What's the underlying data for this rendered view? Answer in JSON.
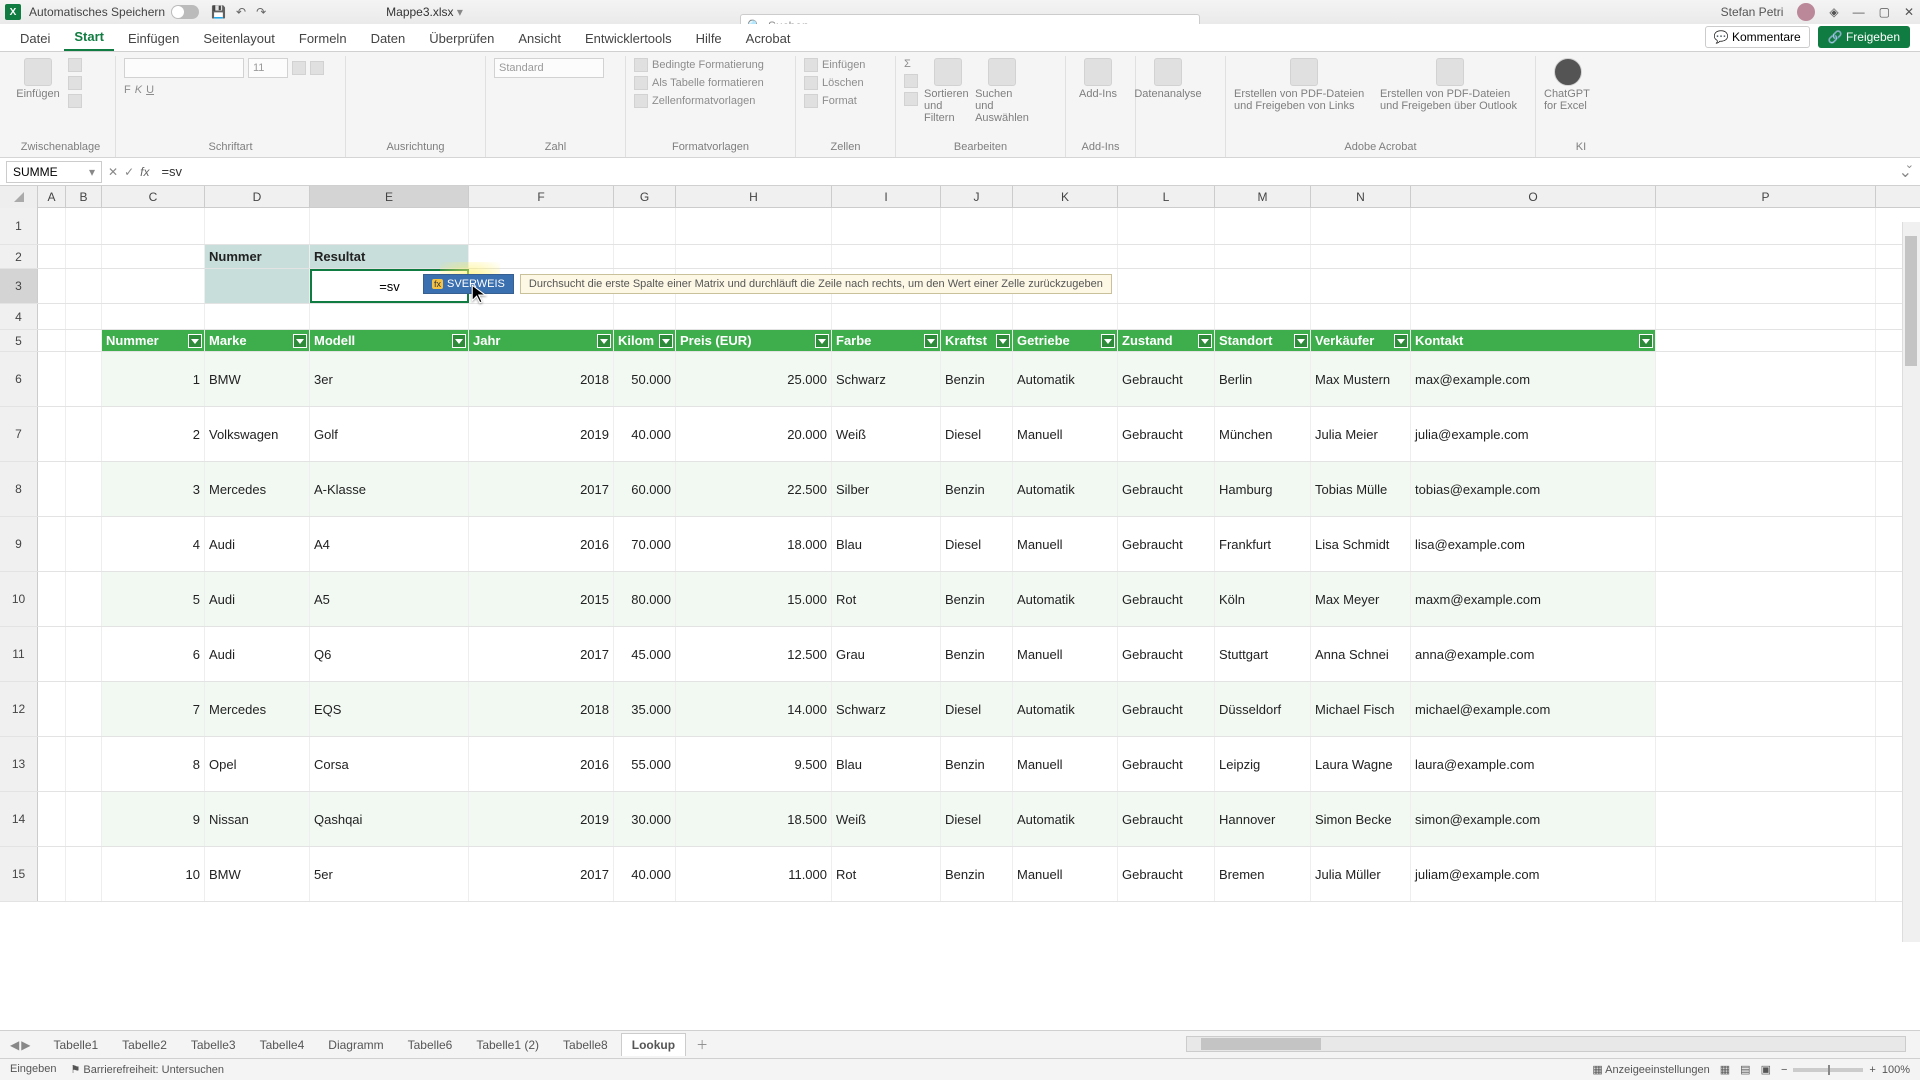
{
  "titlebar": {
    "autosave_label": "Automatisches Speichern",
    "doc_name": "Mappe3.xlsx",
    "search_placeholder": "Suchen",
    "user_name": "Stefan Petri"
  },
  "menu": {
    "tabs": [
      "Datei",
      "Start",
      "Einfügen",
      "Seitenlayout",
      "Formeln",
      "Daten",
      "Überprüfen",
      "Ansicht",
      "Entwicklertools",
      "Hilfe",
      "Acrobat"
    ],
    "active": 1,
    "comments": "Kommentare",
    "share": "Freigeben"
  },
  "ribbon": {
    "groups": {
      "clipboard": "Zwischenablage",
      "clipboard_btn": "Einfügen",
      "font": "Schriftart",
      "align": "Ausrichtung",
      "number": "Zahl",
      "number_fmt": "Standard",
      "styles": "Formatvorlagen",
      "styles_items": [
        "Bedingte Formatierung",
        "Als Tabelle formatieren",
        "Zellenformatvorlagen"
      ],
      "cells": "Zellen",
      "cells_items": [
        "Einfügen",
        "Löschen",
        "Format"
      ],
      "edit": "Bearbeiten",
      "edit_sort": "Sortieren und Filtern",
      "edit_find": "Suchen und Auswählen",
      "addins": "Add-Ins",
      "addins_btn": "Add-Ins",
      "analysis": "Datenanalyse",
      "acrobat": "Adobe Acrobat",
      "acrobat1": "Erstellen von PDF-Dateien und Freigeben von Links",
      "acrobat2": "Erstellen von PDF-Dateien und Freigeben über Outlook",
      "ai": "KI",
      "ai_btn": "ChatGPT for Excel"
    }
  },
  "fbar": {
    "namebox": "SUMME",
    "formula": "=sv"
  },
  "columns": [
    "A",
    "B",
    "C",
    "D",
    "E",
    "F",
    "G",
    "H",
    "I",
    "J",
    "K",
    "L",
    "M",
    "N",
    "O",
    "P"
  ],
  "lookup": {
    "nummer": "Nummer",
    "resultat": "Resultat",
    "editing": "=sv"
  },
  "autocomplete": {
    "fn": "SVERWEIS",
    "tip": "Durchsucht die erste Spalte einer Matrix und durchläuft die Zeile nach rechts, um den Wert einer Zelle zurückzugeben"
  },
  "table": {
    "headers": [
      "Nummer",
      "Marke",
      "Modell",
      "Jahr",
      "Kilom",
      "Preis (EUR)",
      "Farbe",
      "Kraftst",
      "Getriebe",
      "Zustand",
      "Standort",
      "Verkäufer",
      "Kontakt"
    ],
    "rows": [
      {
        "n": "1",
        "marke": "BMW",
        "modell": "3er",
        "jahr": "2018",
        "km": "50.000",
        "preis": "25.000",
        "farbe": "Schwarz",
        "kraft": "Benzin",
        "getr": "Automatik",
        "zust": "Gebraucht",
        "ort": "Berlin",
        "verk": "Max Mustern",
        "kontakt": "max@example.com"
      },
      {
        "n": "2",
        "marke": "Volkswagen",
        "modell": "Golf",
        "jahr": "2019",
        "km": "40.000",
        "preis": "20.000",
        "farbe": "Weiß",
        "kraft": "Diesel",
        "getr": "Manuell",
        "zust": "Gebraucht",
        "ort": "München",
        "verk": "Julia Meier",
        "kontakt": "julia@example.com"
      },
      {
        "n": "3",
        "marke": "Mercedes",
        "modell": "A-Klasse",
        "jahr": "2017",
        "km": "60.000",
        "preis": "22.500",
        "farbe": "Silber",
        "kraft": "Benzin",
        "getr": "Automatik",
        "zust": "Gebraucht",
        "ort": "Hamburg",
        "verk": "Tobias Mülle",
        "kontakt": "tobias@example.com"
      },
      {
        "n": "4",
        "marke": "Audi",
        "modell": "A4",
        "jahr": "2016",
        "km": "70.000",
        "preis": "18.000",
        "farbe": "Blau",
        "kraft": "Diesel",
        "getr": "Manuell",
        "zust": "Gebraucht",
        "ort": "Frankfurt",
        "verk": "Lisa Schmidt",
        "kontakt": "lisa@example.com"
      },
      {
        "n": "5",
        "marke": "Audi",
        "modell": "A5",
        "jahr": "2015",
        "km": "80.000",
        "preis": "15.000",
        "farbe": "Rot",
        "kraft": "Benzin",
        "getr": "Automatik",
        "zust": "Gebraucht",
        "ort": "Köln",
        "verk": "Max Meyer",
        "kontakt": "maxm@example.com"
      },
      {
        "n": "6",
        "marke": "Audi",
        "modell": "Q6",
        "jahr": "2017",
        "km": "45.000",
        "preis": "12.500",
        "farbe": "Grau",
        "kraft": "Benzin",
        "getr": "Manuell",
        "zust": "Gebraucht",
        "ort": "Stuttgart",
        "verk": "Anna Schnei",
        "kontakt": "anna@example.com"
      },
      {
        "n": "7",
        "marke": "Mercedes",
        "modell": "EQS",
        "jahr": "2018",
        "km": "35.000",
        "preis": "14.000",
        "farbe": "Schwarz",
        "kraft": "Diesel",
        "getr": "Automatik",
        "zust": "Gebraucht",
        "ort": "Düsseldorf",
        "verk": "Michael Fisch",
        "kontakt": "michael@example.com"
      },
      {
        "n": "8",
        "marke": "Opel",
        "modell": "Corsa",
        "jahr": "2016",
        "km": "55.000",
        "preis": "9.500",
        "farbe": "Blau",
        "kraft": "Benzin",
        "getr": "Manuell",
        "zust": "Gebraucht",
        "ort": "Leipzig",
        "verk": "Laura Wagne",
        "kontakt": "laura@example.com"
      },
      {
        "n": "9",
        "marke": "Nissan",
        "modell": "Qashqai",
        "jahr": "2019",
        "km": "30.000",
        "preis": "18.500",
        "farbe": "Weiß",
        "kraft": "Diesel",
        "getr": "Automatik",
        "zust": "Gebraucht",
        "ort": "Hannover",
        "verk": "Simon Becke",
        "kontakt": "simon@example.com"
      },
      {
        "n": "10",
        "marke": "BMW",
        "modell": "5er",
        "jahr": "2017",
        "km": "40.000",
        "preis": "11.000",
        "farbe": "Rot",
        "kraft": "Benzin",
        "getr": "Manuell",
        "zust": "Gebraucht",
        "ort": "Bremen",
        "verk": "Julia Müller",
        "kontakt": "juliam@example.com"
      }
    ]
  },
  "sheets": {
    "tabs": [
      "Tabelle1",
      "Tabelle2",
      "Tabelle3",
      "Tabelle4",
      "Diagramm",
      "Tabelle6",
      "Tabelle1 (2)",
      "Tabelle8",
      "Lookup"
    ],
    "active": 8
  },
  "statusbar": {
    "mode": "Eingeben",
    "access": "Barrierefreiheit: Untersuchen",
    "display": "Anzeigeeinstellungen",
    "zoom": "100%"
  }
}
